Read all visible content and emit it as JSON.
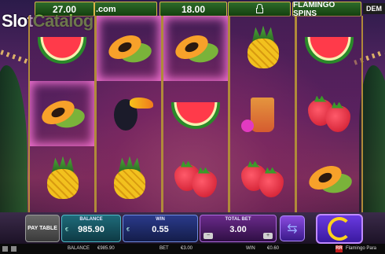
{
  "header": {
    "seg1": "27.00",
    "seg2": "",
    "seg3": "18.00",
    "seg5": "FLAMINGO SPINS",
    "demo": "DEM"
  },
  "watermark": {
    "slot": "Slot",
    "catalog": "Catalog",
    "com": ".com"
  },
  "reels": [
    [
      "watermelon",
      "papaya",
      "pineapple"
    ],
    [
      "papaya",
      "toucan",
      "pineapple"
    ],
    [
      "papaya",
      "watermelon",
      "strawberry"
    ],
    [
      "pineapple",
      "cocktail",
      "strawberry"
    ],
    [
      "watermelon",
      "strawberry",
      "papaya"
    ]
  ],
  "highlighted_symbols": [
    "papaya"
  ],
  "controls": {
    "paytable_label": "PAY TABLE",
    "balance_label": "BALANCE",
    "balance_value": "985.90",
    "win_label": "WIN",
    "win_value": "0.55",
    "total_bet_label": "TOTAL BET",
    "total_bet_value": "3.00",
    "currency": "€",
    "bet_minus": "−",
    "bet_plus": "+"
  },
  "status_bar": {
    "balance_label": "BALANCE",
    "balance_value": "€985.90",
    "bet_label": "BET",
    "bet_value": "€3.00",
    "win_label": "WIN",
    "win_value": "€0.60",
    "game_title": "Flamingo Para",
    "logo_text": "RR"
  },
  "colors": {
    "spin_ring": "#ffd21b",
    "highlight_glow": "#ff78dc",
    "reel_border": "#b08a3a"
  }
}
